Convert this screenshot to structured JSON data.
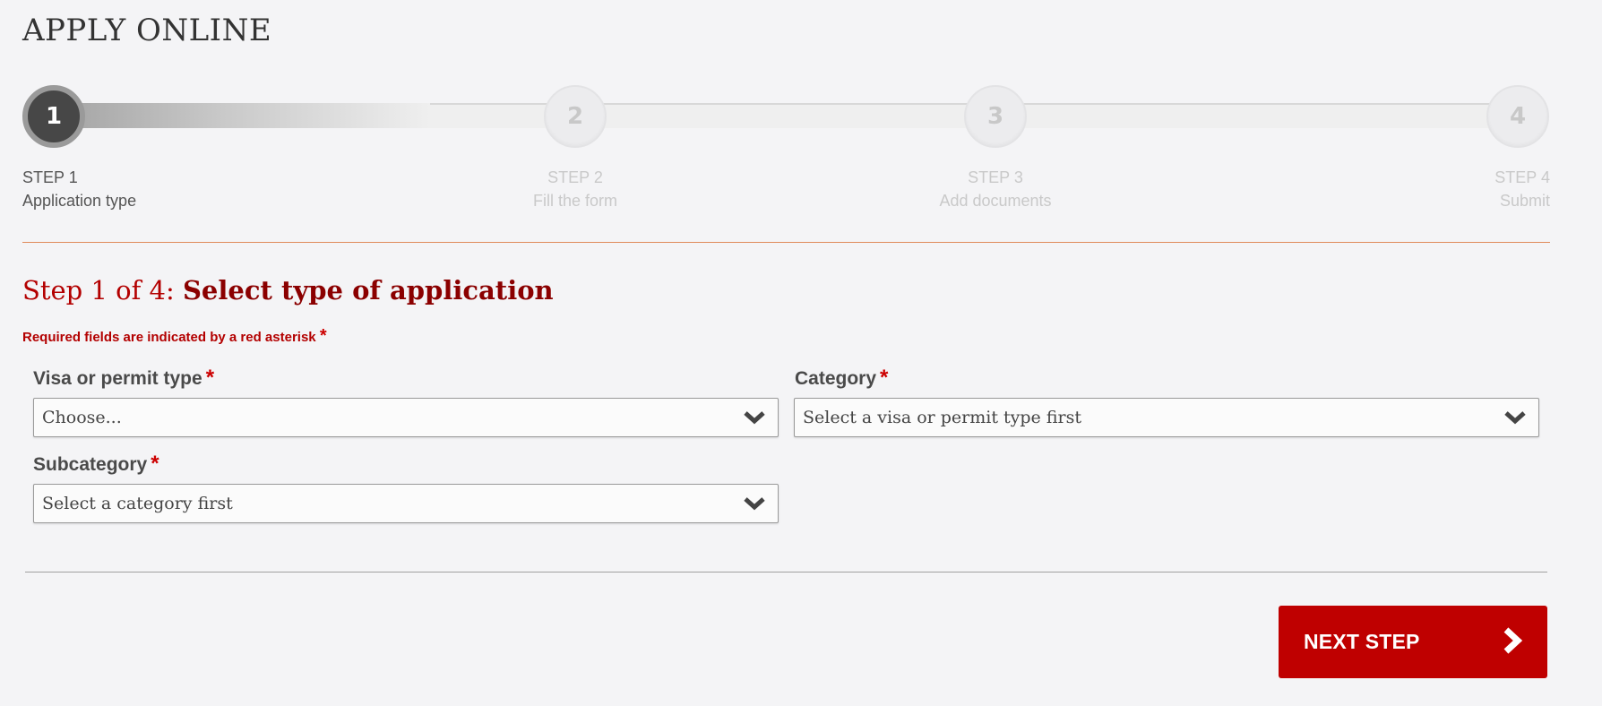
{
  "page": {
    "title": "APPLY ONLINE"
  },
  "progress": {
    "current_step": 1,
    "total_steps": 4,
    "steps": [
      {
        "number": "1",
        "step_label": "STEP 1",
        "name": "Application type",
        "state": "active"
      },
      {
        "number": "2",
        "step_label": "STEP 2",
        "name": "Fill the form",
        "state": "inactive"
      },
      {
        "number": "3",
        "step_label": "STEP 3",
        "name": "Add documents",
        "state": "inactive"
      },
      {
        "number": "4",
        "step_label": "STEP 4",
        "name": "Submit",
        "state": "inactive"
      }
    ]
  },
  "form": {
    "heading_prefix": "Step 1 of 4: ",
    "heading_main": "Select type of application",
    "required_note": "Required fields are indicated by a red asterisk",
    "required_marker": "*",
    "fields": {
      "visa_type": {
        "label": "Visa or permit type",
        "value": "Choose..."
      },
      "category": {
        "label": "Category",
        "value": "Select a visa or permit type first"
      },
      "subcategory": {
        "label": "Subcategory",
        "value": "Select a category first"
      }
    }
  },
  "actions": {
    "next_label": "NEXT STEP",
    "next_icon": "chevron-right-icon"
  },
  "colors": {
    "accent_red": "#bf0000",
    "heading_red": "#b30000",
    "heading_dark_red": "#8b0000",
    "divider_orange": "#e08a5a",
    "background": "#f4f4f6"
  }
}
